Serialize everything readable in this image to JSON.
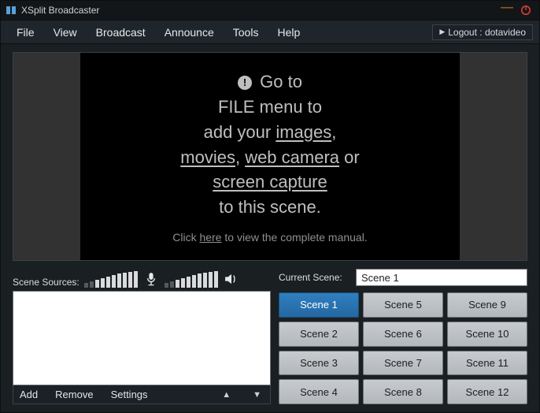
{
  "titlebar": {
    "title": "XSplit Broadcaster"
  },
  "menubar": {
    "items": [
      "File",
      "View",
      "Broadcast",
      "Announce",
      "Tools",
      "Help"
    ],
    "logout_prefix": "Logout : ",
    "logout_user": "dotavideo"
  },
  "preview": {
    "hint_l1a": "Go to",
    "hint_l2": "FILE menu to",
    "hint_l3a": "add your ",
    "hint_l3b": "images",
    "hint_l3c": ",",
    "hint_l4a": "movies",
    "hint_l4b": ", ",
    "hint_l4c": "web camera",
    "hint_l4d": " or",
    "hint_l5": "screen capture",
    "hint_l6": "to this scene.",
    "manual_a": "Click ",
    "manual_b": "here",
    "manual_c": " to view the complete manual."
  },
  "sources": {
    "label": "Scene Sources:",
    "actions": {
      "add": "Add",
      "remove": "Remove",
      "settings": "Settings"
    }
  },
  "scenes": {
    "label": "Current Scene:",
    "current": "Scene 1",
    "buttons": [
      "Scene 1",
      "Scene 2",
      "Scene 3",
      "Scene 4",
      "Scene 5",
      "Scene 6",
      "Scene 7",
      "Scene 8",
      "Scene 9",
      "Scene 10",
      "Scene 11",
      "Scene 12"
    ],
    "active_index": 0
  },
  "colors": {
    "accent": "#2f7fbf"
  }
}
